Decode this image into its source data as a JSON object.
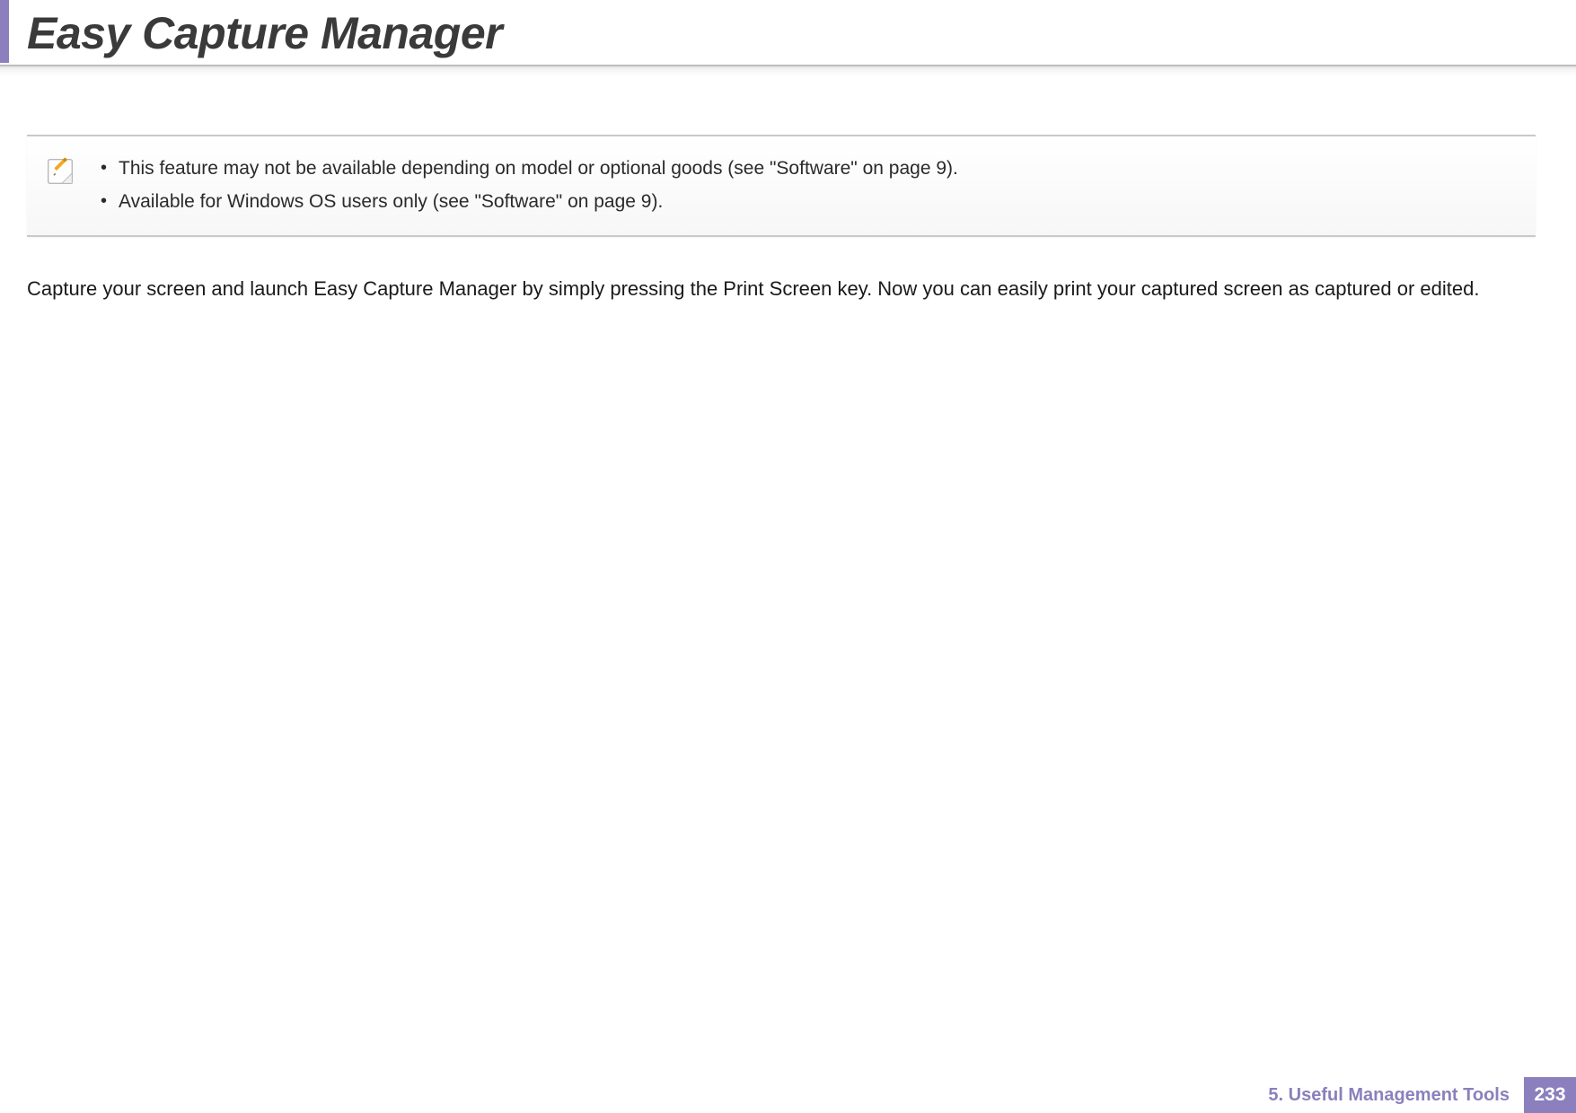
{
  "header": {
    "title": "Easy Capture Manager"
  },
  "note": {
    "bullets": [
      "This feature may not be available depending on model or optional goods (see \"Software\" on page 9).",
      "Available for Windows OS users only (see \"Software\" on page 9)."
    ]
  },
  "body": {
    "paragraph": "Capture your screen and launch Easy Capture Manager by simply pressing the Print Screen key. Now you can easily print your captured screen as captured or edited."
  },
  "footer": {
    "chapter": "5.  Useful Management Tools",
    "page_number": "233"
  }
}
